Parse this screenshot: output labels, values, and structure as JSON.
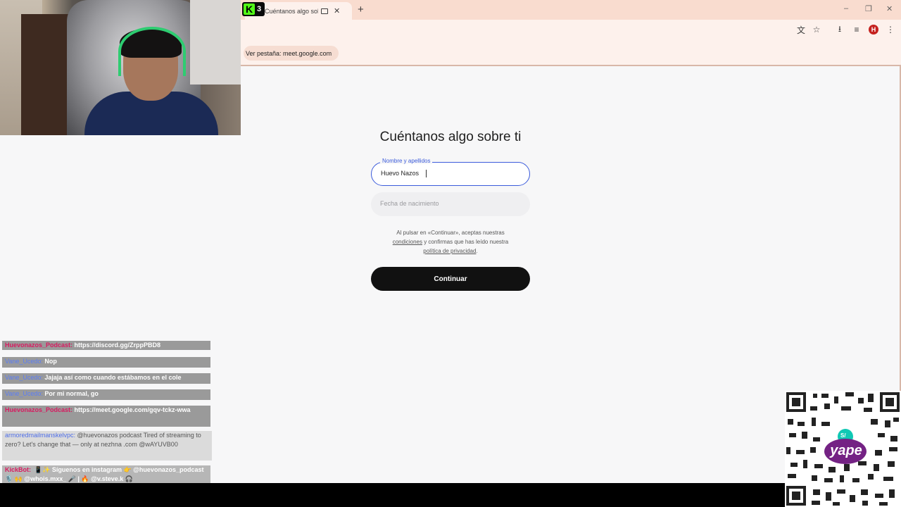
{
  "kick_badge": {
    "count": "3"
  },
  "browser": {
    "tab_title": "Cuéntanos algo sobre ti - G",
    "tab_close_glyph": "✕",
    "new_tab_glyph": "+",
    "profile_initial": "H",
    "view_tab_chip": "Ver pestaña: meet.google.com",
    "window_controls": {
      "minimize": "–",
      "maximize": "❐",
      "close": "✕"
    },
    "toolbar_icons": {
      "translate": "文",
      "star": "☆",
      "download": "⭳",
      "media": "≡",
      "menu": "⋮"
    }
  },
  "form": {
    "heading": "Cuéntanos algo sobre ti",
    "name_label": "Nombre y apellidos",
    "name_value": "Huevo Nazos",
    "dob_placeholder": "Fecha de nacimiento",
    "terms_line1": "Al pulsar en «Continuar», aceptas nuestras",
    "terms_link1": "condiciones",
    "terms_line2": " y confirmas que has leído nuestra",
    "terms_link2": "política de privacidad",
    "terms_end": ".",
    "continue_label": "Continuar"
  },
  "chat": [
    {
      "user": "Huevonazos_Podcast:",
      "text": " https://discord.gg/ZrppPBD8"
    },
    {
      "user": "Vane_Ucedo:",
      "text": " Nop"
    },
    {
      "user": "Vane_Ucedo:",
      "text": " Jajaja así como cuando estábamos en el cole"
    },
    {
      "user": "Vane_Ucedo:",
      "text": " Por mi normal, go"
    },
    {
      "user": "Huevonazos_Podcast:",
      "text": " https://meet.google.com/gqv-tckz-wwa"
    },
    {
      "user": "armoredmailmanskelvpc:",
      "text": " @huevonazos podcast Tired of streaming to zero? Let's change that — only at nezhna .com @wAYUVB00"
    },
    {
      "user": "KickBot:",
      "text": " 📲 ✨ Síguenos en instagram 👉 @huevonazos_podcast 🎙️ 🙌 @whois.mxx_ 🎤 | 🔥 @v.steve.k 🎧"
    }
  ],
  "qr": {
    "brand": "yape",
    "currency": "S/"
  }
}
